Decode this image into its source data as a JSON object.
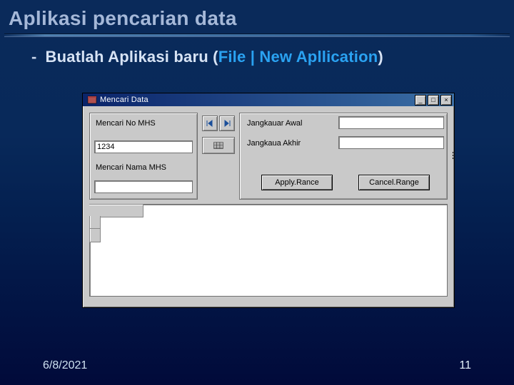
{
  "slide": {
    "title": "Aplikasi pencarian data",
    "bullet_dash": "-",
    "bullet_text": "Buatlah Aplikasi baru",
    "paren_open": "(",
    "menu_path": "File | New Apllication",
    "paren_close": ")"
  },
  "window": {
    "caption": "Mencari Data",
    "min_glyph": "_",
    "max_glyph": "□",
    "close_glyph": "×",
    "left_panel": {
      "label_no": "Mencari No MHS",
      "input_no_value": "1234",
      "label_nama": "Mencari Nama MHS",
      "input_nama_value": ""
    },
    "right_panel": {
      "label_awal": "Jangkauar Awal",
      "input_awal_value": "",
      "label_akhir": "Jangkaua Akhir",
      "input_akhir_value": "",
      "btn_apply": "Apply.Rance",
      "btn_cancel": "Cancel.Range"
    },
    "nav_icons": {
      "first": "first-record-icon",
      "last": "last-record-icon",
      "list": "record-list-icon"
    }
  },
  "footer": {
    "date": "6/8/2021",
    "page": "11"
  }
}
